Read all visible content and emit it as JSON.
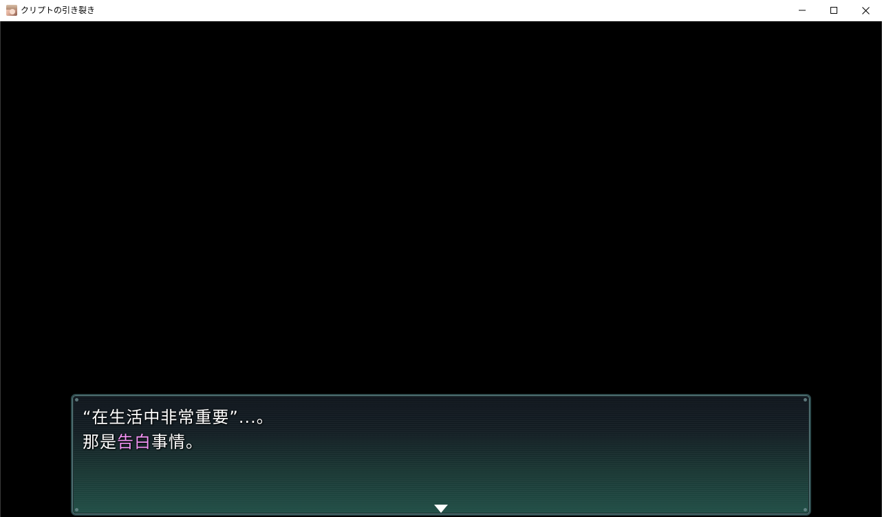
{
  "window": {
    "title": "クリプトの引き裂き",
    "app_icon": "character-portrait-icon",
    "controls": {
      "minimize_icon": "minimize-icon",
      "maximize_icon": "maximize-icon",
      "close_icon": "close-icon"
    }
  },
  "message": {
    "line1": "“在生活中非常重要”...。",
    "line2_before": "那是",
    "line2_highlight": "告白",
    "line2_after": "事情。",
    "highlight_color": "#f294f4",
    "continue_icon": "continue-arrow-icon"
  },
  "colors": {
    "background": "#000000",
    "text": "#ffffff",
    "box_top": "#10161d",
    "box_bottom": "#214f47"
  }
}
